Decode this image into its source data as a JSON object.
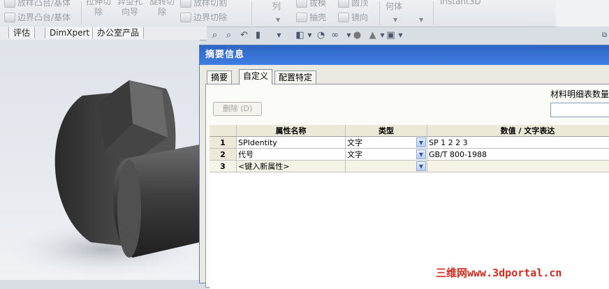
{
  "ribbon": {
    "boss_extrude": "放样凸台/基体",
    "boundary_boss": "边界凸台/基体",
    "extruded_cut": "拉伸切除",
    "hole_wizard": "异型孔向导",
    "revolved_cut": "旋转切除",
    "lofted_cut": "放样切割",
    "boundary_cut": "边界切除",
    "pattern": "列",
    "draft": "拔模",
    "shell": "抽壳",
    "dome": "圆顶",
    "mirror": "镜向",
    "geometry": "何体",
    "instant3d": "Instant3D"
  },
  "tabs": [
    "评估",
    "DimXpert",
    "办公室产品"
  ],
  "dialog": {
    "title": "摘要信息",
    "tabs": [
      "摘要",
      "自定义",
      "配置特定"
    ],
    "delete_button": "删除 (D)",
    "bom_quantity_label": "材料明细表数量",
    "grid": {
      "headers": [
        "属性名称",
        "类型",
        "数值 / 文字表达"
      ],
      "rows": [
        {
          "num": "1",
          "name": "SPIdentity",
          "type": "文字",
          "value": "SP 1 2 2 3"
        },
        {
          "num": "2",
          "name": "代号",
          "type": "文字",
          "value": "GB/T 800-1988"
        },
        {
          "num": "3",
          "name": "<键入新属性>",
          "type": "",
          "value": ""
        }
      ]
    }
  },
  "watermark": "三维网www.3dportal.cn"
}
